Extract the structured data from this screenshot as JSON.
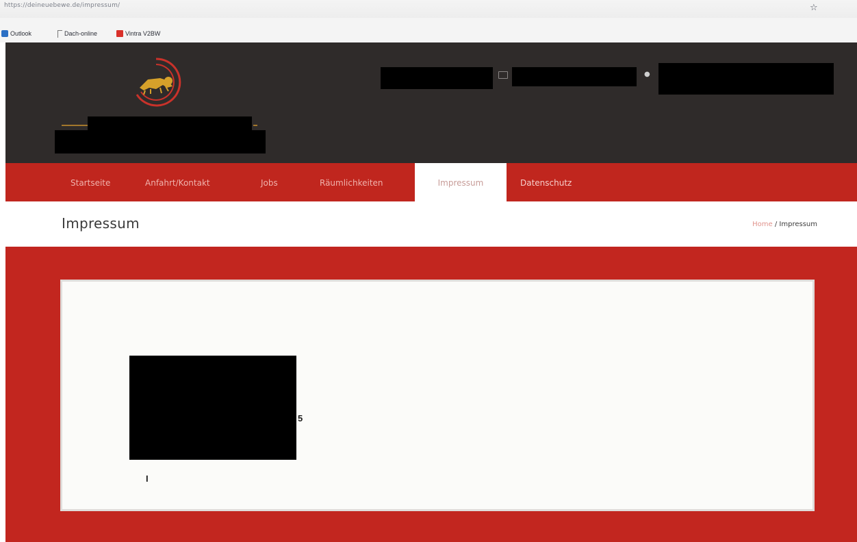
{
  "browser": {
    "url": "https://deineuebewe.de/impressum/",
    "bookmarks": [
      "Outlook",
      "Dach-online",
      "Vintra V2BW"
    ]
  },
  "nav": {
    "items": [
      "Startseite",
      "Anfahrt/Kontakt",
      "Jobs",
      "Räumlichkeiten",
      "Impressum",
      "Datenschutz"
    ],
    "active": "Impressum"
  },
  "page": {
    "title": "Impressum",
    "breadcrumb_home": "Home",
    "breadcrumb_sep": " / ",
    "breadcrumb_current": "Impressum"
  },
  "content": {
    "partial_text_1": "5",
    "partial_text_2": "I"
  },
  "icons": {
    "bookmark_star": "star-icon",
    "email": "mail-icon",
    "location": "pin-icon",
    "logo": "lion-logo"
  },
  "colors": {
    "header_bg": "#2f2b2a",
    "nav_bg": "#c0261e",
    "content_bg": "#c2261f",
    "logo_red": "#c9322a",
    "logo_gold": "#d6a12a"
  }
}
